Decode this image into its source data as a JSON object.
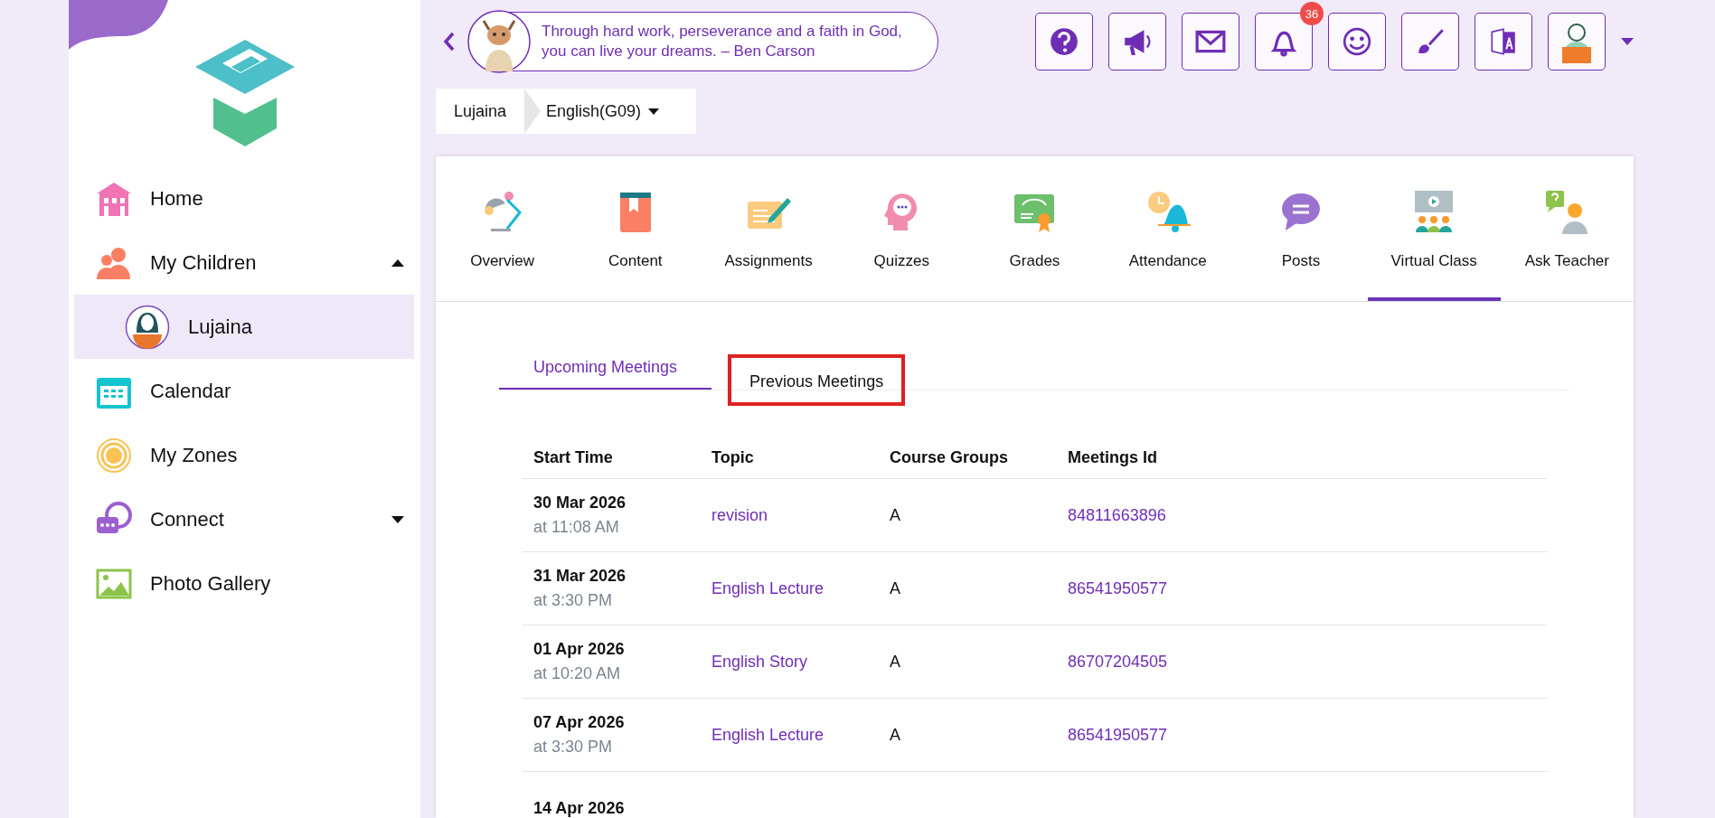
{
  "header": {
    "quote": "Through hard work, perseverance and a faith in God, you can live your dreams. – Ben Carson",
    "notifications_badge": "36"
  },
  "breadcrumb": {
    "student": "Lujaina",
    "course": "English(G09)"
  },
  "sidebar": {
    "items": [
      {
        "label": "Home",
        "kind": "home"
      },
      {
        "label": "My Children",
        "kind": "children",
        "expanded": true,
        "children": [
          {
            "label": "Lujaina",
            "selected": true
          }
        ]
      },
      {
        "label": "Calendar",
        "kind": "calendar"
      },
      {
        "label": "My Zones",
        "kind": "zones"
      },
      {
        "label": "Connect",
        "kind": "connect",
        "expanded": false
      },
      {
        "label": "Photo Gallery",
        "kind": "gallery"
      }
    ]
  },
  "course_tabs": [
    {
      "label": "Overview",
      "kind": "overview",
      "selected": false
    },
    {
      "label": "Content",
      "kind": "content",
      "selected": false
    },
    {
      "label": "Assignments",
      "kind": "assignments",
      "selected": false
    },
    {
      "label": "Quizzes",
      "kind": "quizzes",
      "selected": false
    },
    {
      "label": "Grades",
      "kind": "grades",
      "selected": false
    },
    {
      "label": "Attendance",
      "kind": "attendance",
      "selected": false
    },
    {
      "label": "Posts",
      "kind": "posts",
      "selected": false
    },
    {
      "label": "Virtual Class",
      "kind": "virtual",
      "selected": true
    },
    {
      "label": "Ask Teacher",
      "kind": "ask",
      "selected": false
    }
  ],
  "meeting_tabs": [
    {
      "label": "Upcoming Meetings",
      "selected": true,
      "highlighted": false
    },
    {
      "label": "Previous Meetings",
      "selected": false,
      "highlighted": true
    }
  ],
  "table": {
    "columns": [
      "Start Time",
      "Topic",
      "Course Groups",
      "Meetings Id"
    ],
    "rows": [
      {
        "date": "30 Mar 2026",
        "time": "at 11:08 AM",
        "topic": "revision",
        "group": "A",
        "meeting_id": "84811663896"
      },
      {
        "date": "31 Mar 2026",
        "time": "at 3:30 PM",
        "topic": "English Lecture",
        "group": "A",
        "meeting_id": "86541950577"
      },
      {
        "date": "01 Apr 2026",
        "time": "at 10:20 AM",
        "topic": "English Story",
        "group": "A",
        "meeting_id": "86707204505"
      },
      {
        "date": "07 Apr 2026",
        "time": "at 3:30 PM",
        "topic": "English Lecture",
        "group": "A",
        "meeting_id": "86541950577"
      },
      {
        "date": "14 Apr 2026"
      }
    ]
  }
}
